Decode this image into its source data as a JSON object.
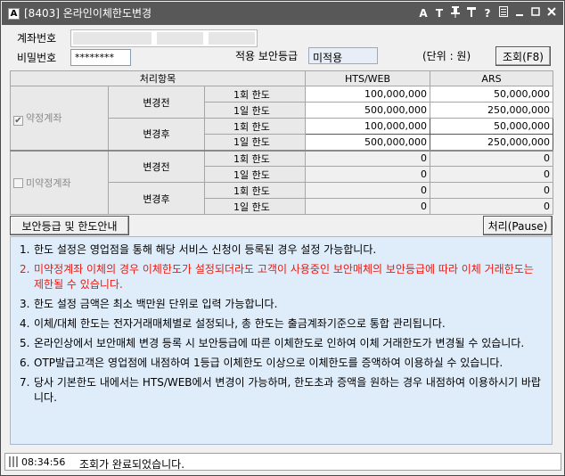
{
  "window": {
    "app_icon": "A",
    "title": "[8403] 온라인이체한도변경",
    "controls": [
      "A",
      "T",
      "pin",
      "tools",
      "?",
      "doc",
      "_",
      "□",
      "×"
    ]
  },
  "form": {
    "account_label": "계좌번호",
    "password_label": "비밀번호",
    "password_value": "********",
    "security_level_label": "적용 보안등급",
    "security_level_value": "미적용",
    "unit_label": "(단위 : 원)",
    "query_button": "조회(F8)"
  },
  "table": {
    "headers": {
      "item": "처리항목",
      "hts": "HTS/WEB",
      "ars": "ARS"
    },
    "groups": [
      {
        "name": "약정계좌",
        "checked": true,
        "rows": [
          {
            "phase": "변경전",
            "limit": "1회 한도",
            "hts": "100,000,000",
            "ars": "50,000,000"
          },
          {
            "phase": "변경전",
            "limit": "1일 한도",
            "hts": "500,000,000",
            "ars": "250,000,000"
          },
          {
            "phase": "변경후",
            "limit": "1회 한도",
            "hts": "100,000,000",
            "ars": "50,000,000"
          },
          {
            "phase": "변경후",
            "limit": "1일 한도",
            "hts": "500,000,000",
            "ars": "250,000,000"
          }
        ]
      },
      {
        "name": "미약정계좌",
        "checked": false,
        "rows": [
          {
            "phase": "변경전",
            "limit": "1회 한도",
            "hts": "0",
            "ars": "0"
          },
          {
            "phase": "변경전",
            "limit": "1일 한도",
            "hts": "0",
            "ars": "0"
          },
          {
            "phase": "변경후",
            "limit": "1회 한도",
            "hts": "0",
            "ars": "0"
          },
          {
            "phase": "변경후",
            "limit": "1일 한도",
            "hts": "0",
            "ars": "0"
          }
        ]
      }
    ]
  },
  "buttons": {
    "security_guide": "보안등급 및 한도안내",
    "process": "처리(Pause)"
  },
  "notes": [
    {
      "num": "1.",
      "text": "한도 설정은 영업점을 통해 해당 서비스 신청이 등록된 경우 설정 가능합니다.",
      "color": "#000000"
    },
    {
      "num": "2.",
      "text": "미약정계좌 이체의 경우 이체한도가 설정되더라도 고객이 사용중인 보안매체의 보안등급에 따라 이체 거래한도는 제한될 수 있습니다.",
      "color": "#e8190f"
    },
    {
      "num": "3.",
      "text": "한도 설정 금액은 최소 백만원 단위로 입력 가능합니다.",
      "color": "#000000"
    },
    {
      "num": "4.",
      "text": "이체/대체 한도는 전자거래매체별로 설정되나, 총 한도는 출금계좌기준으로 통합 관리됩니다.",
      "color": "#000000"
    },
    {
      "num": "5.",
      "text": "온라인상에서 보안매체 변경 등록 시 보안등급에 따른 이체한도로 인하여 이체 거래한도가 변경될 수 있습니다.",
      "color": "#000000"
    },
    {
      "num": "6.",
      "text": "OTP발급고객은 영업점에 내점하여 1등급 이체한도 이상으로 이체한도를 증액하여 이용하실 수 있습니다.",
      "color": "#000000"
    },
    {
      "num": "7.",
      "text": "당사 기본한도 내에서는 HTS/WEB에서 변경이 가능하며, 한도초과 증액을 원하는 경우 내점하여 이용하시기 바랍니다.",
      "color": "#000000"
    }
  ],
  "status": {
    "time": "08:34:56",
    "message": "조회가 완료되었습니다."
  }
}
